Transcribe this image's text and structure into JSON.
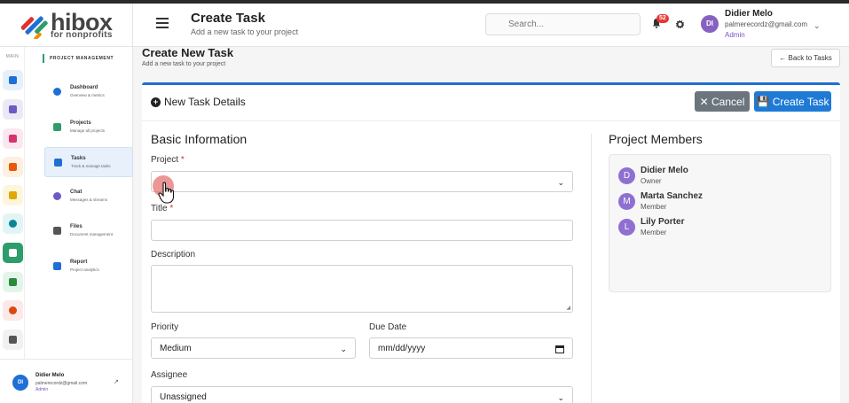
{
  "brand": {
    "name": "hibox",
    "tagline": "for nonprofits"
  },
  "header": {
    "title": "Create Task",
    "subtitle": "Add a new task to your project",
    "search_placeholder": "Search...",
    "notification_count": "52",
    "user": {
      "initials": "DI",
      "name": "Didier Melo",
      "email": "palmerecordz@gmail.com",
      "role": "Admin"
    }
  },
  "rail": {
    "label": "MAIN",
    "items": [
      {
        "name": "home",
        "bg": "#e6f0fb",
        "color": "#1f6fd6"
      },
      {
        "name": "sitemap",
        "bg": "#ece9f7",
        "color": "#6b5bc4"
      },
      {
        "name": "rocket",
        "bg": "#fbe7ef",
        "color": "#d6336c"
      },
      {
        "name": "building",
        "bg": "#fdf0e1",
        "color": "#e8590c"
      },
      {
        "name": "graduation",
        "bg": "#fdf6dc",
        "color": "#e0a800"
      },
      {
        "name": "circle",
        "bg": "#e2f5f5",
        "color": "#0c8599"
      },
      {
        "name": "tasks",
        "bg": "#2e9c6b",
        "color": "#ffffff"
      },
      {
        "name": "users",
        "bg": "#e3f5ea",
        "color": "#2b8a3e"
      },
      {
        "name": "chart-pie",
        "bg": "#fde8e8",
        "color": "#d9480f"
      },
      {
        "name": "gear",
        "bg": "#f1f1f1",
        "color": "#555555"
      }
    ]
  },
  "sidenav": {
    "section_label": "PROJECT MANAGEMENT",
    "items": [
      {
        "title": "Dashboard",
        "desc": "Overview & metrics",
        "color": "#1f6fd6"
      },
      {
        "title": "Projects",
        "desc": "Manage all projects",
        "color": "#2e9c6b"
      },
      {
        "title": "Tasks",
        "desc": "Track & manage tasks",
        "color": "#1f6fd6"
      },
      {
        "title": "Chat",
        "desc": "Messages & streams",
        "color": "#6b5bc4"
      },
      {
        "title": "Files",
        "desc": "Document management",
        "color": "#555555"
      },
      {
        "title": "Report",
        "desc": "Project analytics",
        "color": "#1f6fd6"
      }
    ]
  },
  "footer_user": {
    "initials": "DI",
    "name": "Didier Melo",
    "email": "palmerecordz@gmail.com",
    "role": "Admin"
  },
  "page": {
    "title": "Create New Task",
    "subtitle": "Add a new task to your project",
    "back_label": "Back to Tasks"
  },
  "card": {
    "title": "New Task Details",
    "cancel_label": "Cancel",
    "create_label": "Create Task"
  },
  "form": {
    "section_title": "Basic Information",
    "project_label": "Project",
    "project_value": "",
    "title_label": "Title",
    "title_value": "",
    "description_label": "Description",
    "priority_label": "Priority",
    "priority_value": "Medium",
    "due_date_label": "Due Date",
    "due_date_placeholder": "mm/dd/yyyy",
    "assignee_label": "Assignee",
    "assignee_value": "Unassigned",
    "required_mark": "*"
  },
  "members": {
    "title": "Project Members",
    "list": [
      {
        "initial": "D",
        "name": "Didier Melo",
        "role": "Owner"
      },
      {
        "initial": "M",
        "name": "Marta Sanchez",
        "role": "Member"
      },
      {
        "initial": "L",
        "name": "Lily Porter",
        "role": "Member"
      }
    ]
  }
}
